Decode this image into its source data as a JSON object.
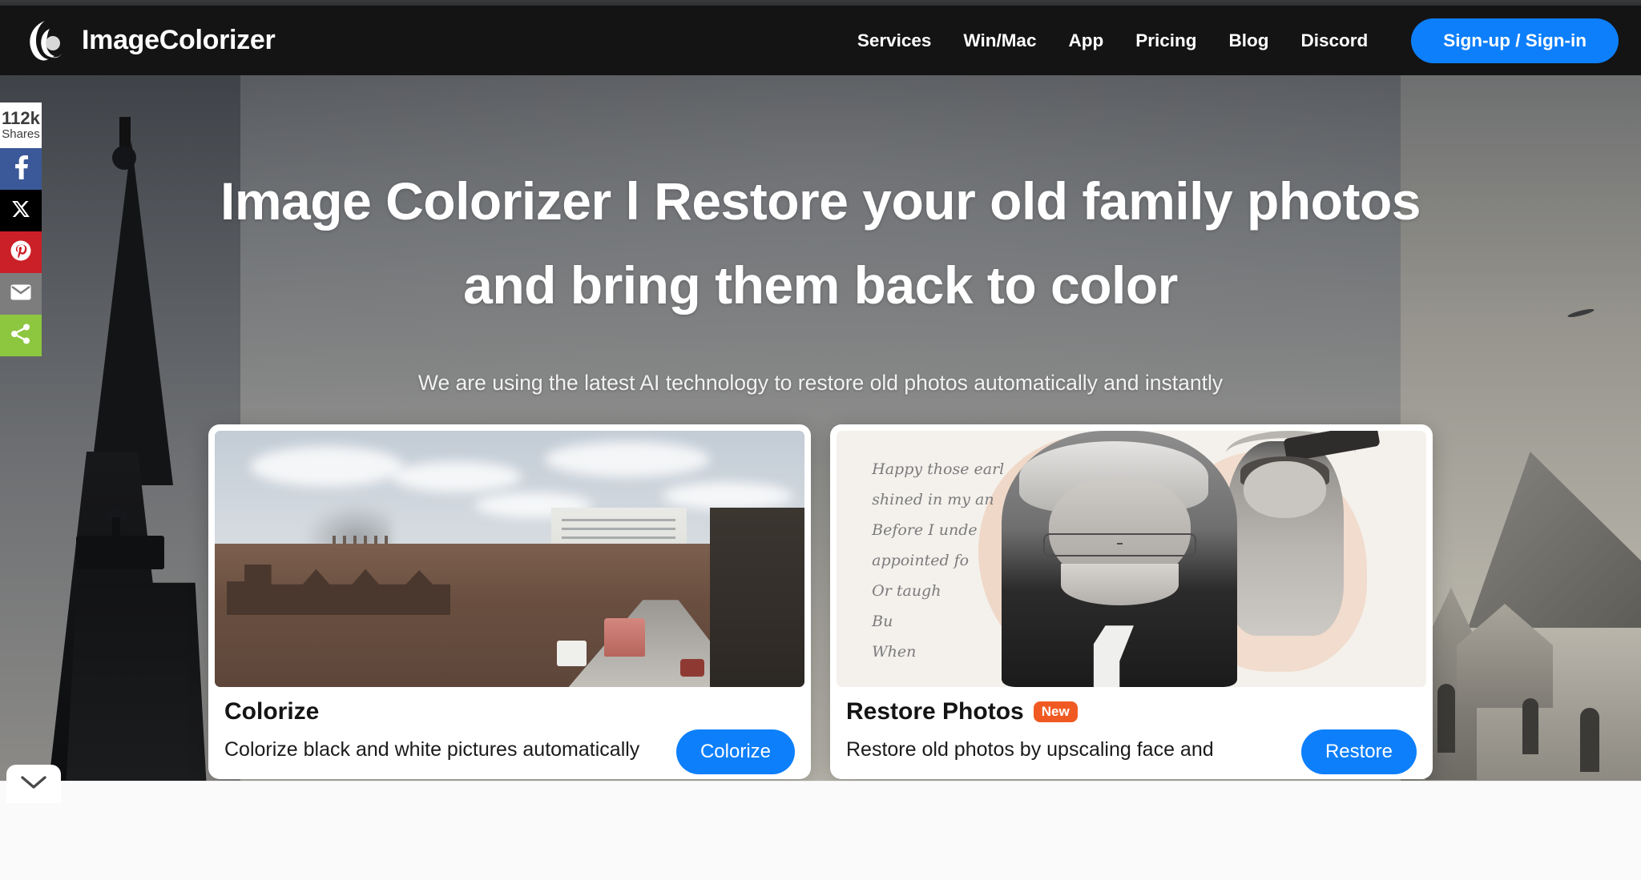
{
  "navbar": {
    "brand_name": "ImageColorizer",
    "logo_icon": "spiral-lens-logo-icon",
    "links": [
      {
        "label": "Services"
      },
      {
        "label": "Win/Mac"
      },
      {
        "label": "App"
      },
      {
        "label": "Pricing"
      },
      {
        "label": "Blog"
      },
      {
        "label": "Discord"
      }
    ],
    "signup_label": "Sign-up / Sign-in",
    "background_color": "#141414",
    "accent_color": "#0d7ffb"
  },
  "hero": {
    "title": "Image Colorizer l Restore your old family photos and bring them back to color",
    "subtitle": "We are using the latest AI technology to restore old photos automatically and instantly"
  },
  "cards": [
    {
      "title": "Colorize",
      "badge": "",
      "description": "Colorize black and white pictures automatically",
      "cta_label": "Colorize",
      "media_alt": "colorized vintage city street with brick row houses, tram and white high-rise"
    },
    {
      "title": "Restore Photos",
      "badge": "New",
      "description": "Restore old photos by upscaling face and",
      "cta_label": "Restore",
      "media_alt": "black and white collage of an elderly man with glasses and a boy, over handwritten script",
      "script_lines": [
        "Happy those earl",
        "shined in my an",
        "Before I unde",
        "appointed fo",
        "Or taugh",
        "Bu",
        "When"
      ]
    }
  ],
  "share_rail": {
    "count": "112k",
    "count_label": "Shares",
    "buttons": [
      {
        "name": "facebook",
        "glyph": "f",
        "color": "#3b5998"
      },
      {
        "name": "x-twitter",
        "glyph": "X",
        "color": "#000000"
      },
      {
        "name": "pinterest",
        "glyph": "P",
        "color": "#cb2027"
      },
      {
        "name": "email",
        "glyph": "envelope",
        "color": "#7d7d7d"
      },
      {
        "name": "more-share",
        "glyph": "share-nodes",
        "color": "#8dc63f"
      }
    ]
  },
  "collapse_tab": {
    "icon": "chevron-down-icon"
  }
}
